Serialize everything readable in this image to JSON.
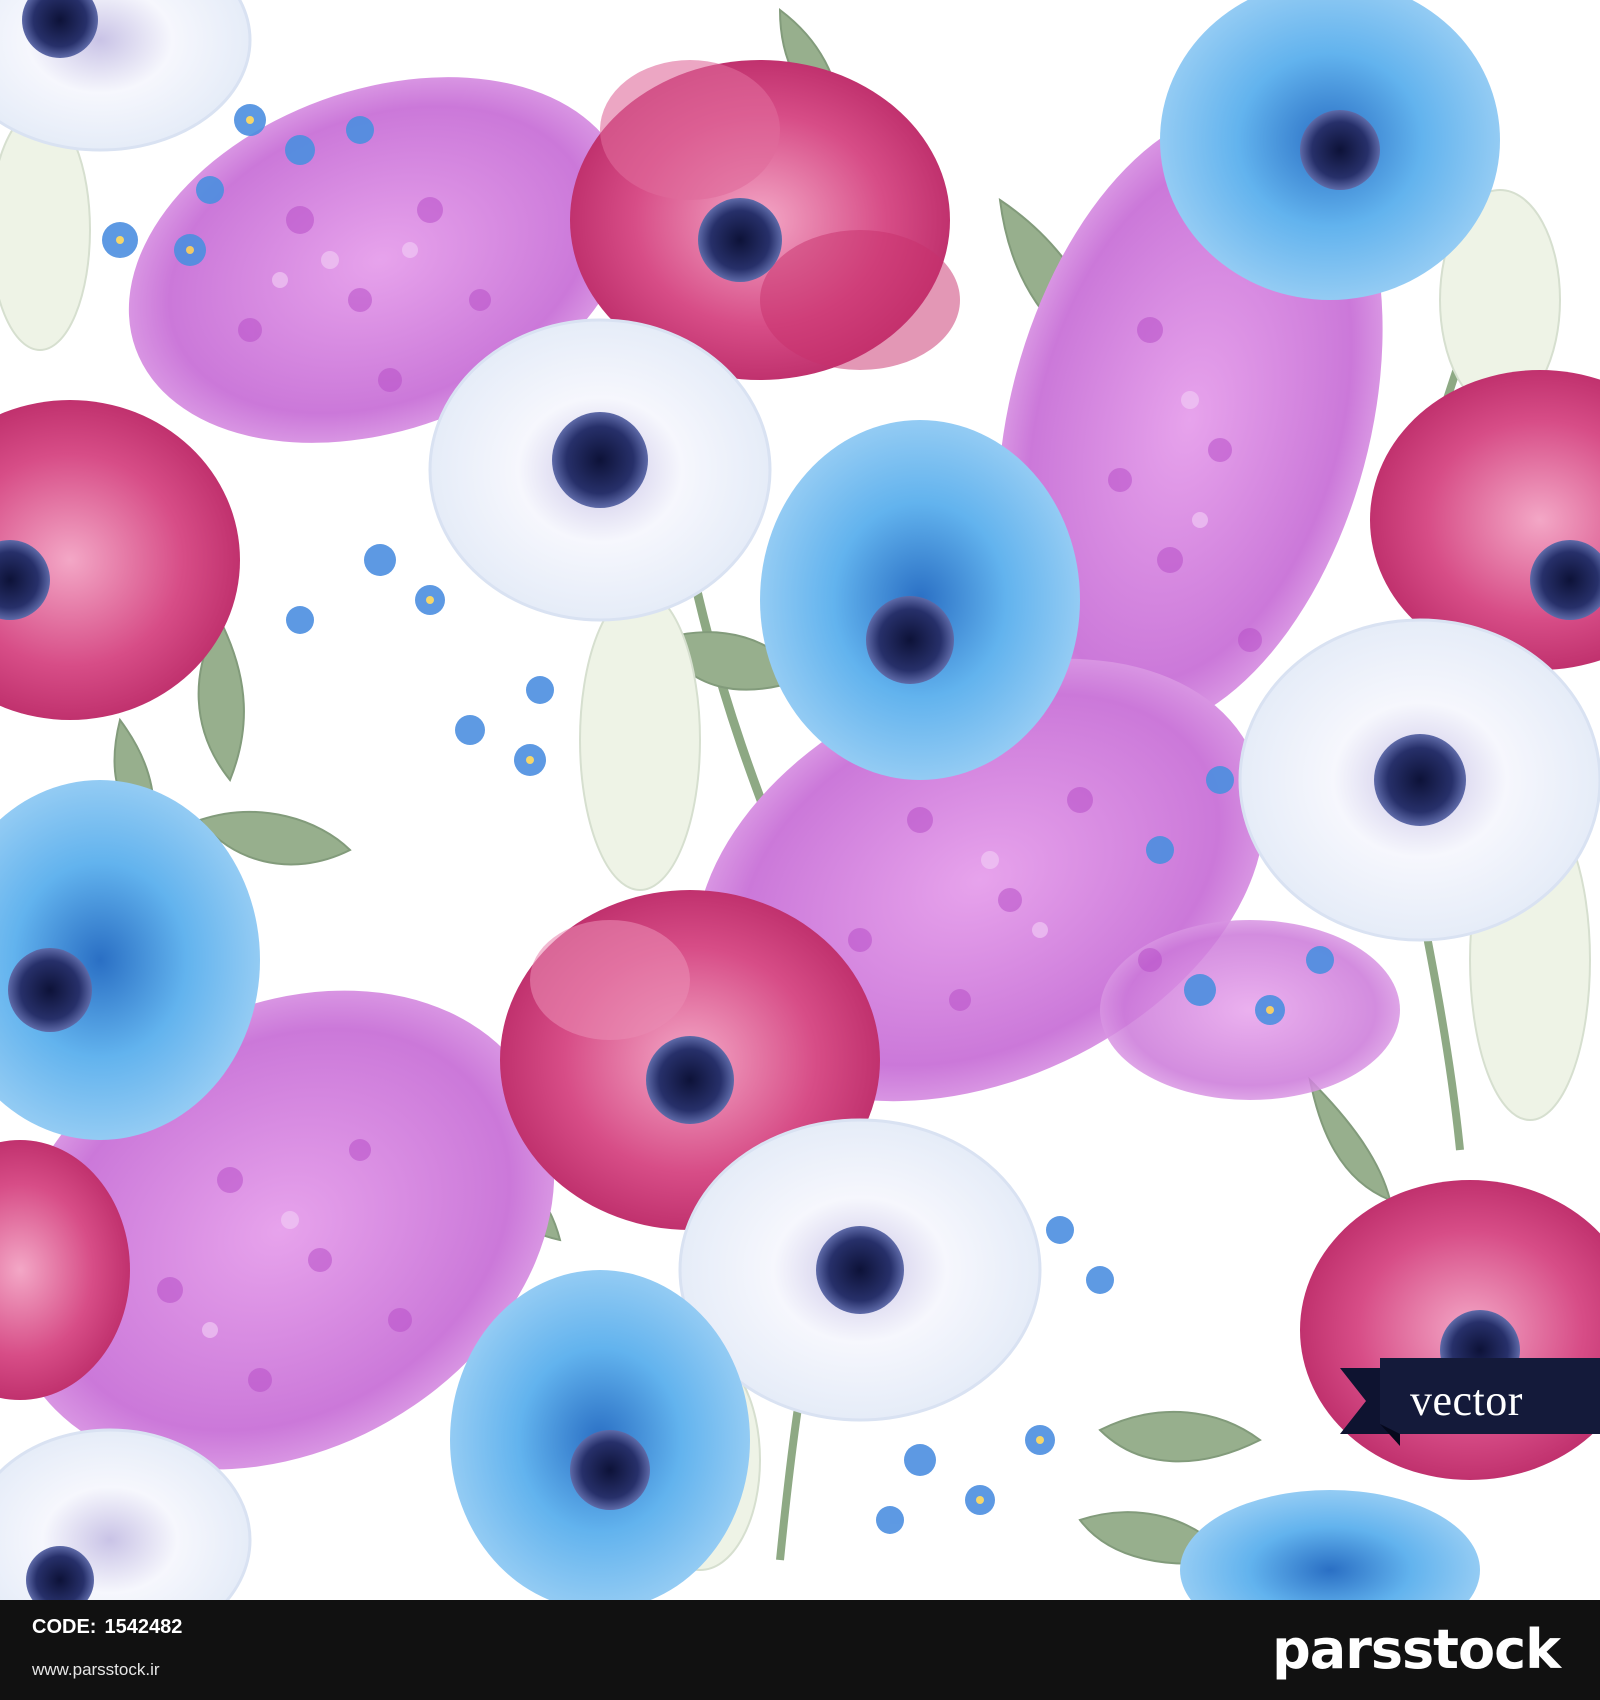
{
  "ribbon": {
    "label": "vector",
    "color": "#141a3a"
  },
  "footer": {
    "code_label": "CODE:",
    "code_value": "1542482",
    "website": "www.parsstock.ir",
    "brand": "parsstock",
    "background": "#111111"
  },
  "palette": {
    "lilac": "#c874d6",
    "magenta_anemone": "#c2346f",
    "blue_anemone": "#4fa3e3",
    "white_anemone": "#eef2fb",
    "forget_me_not": "#4c8fe0",
    "leaf": "#7d9a72",
    "center": "#1e2350"
  },
  "icons": {
    "flower_center": "navy-dot-icon"
  }
}
